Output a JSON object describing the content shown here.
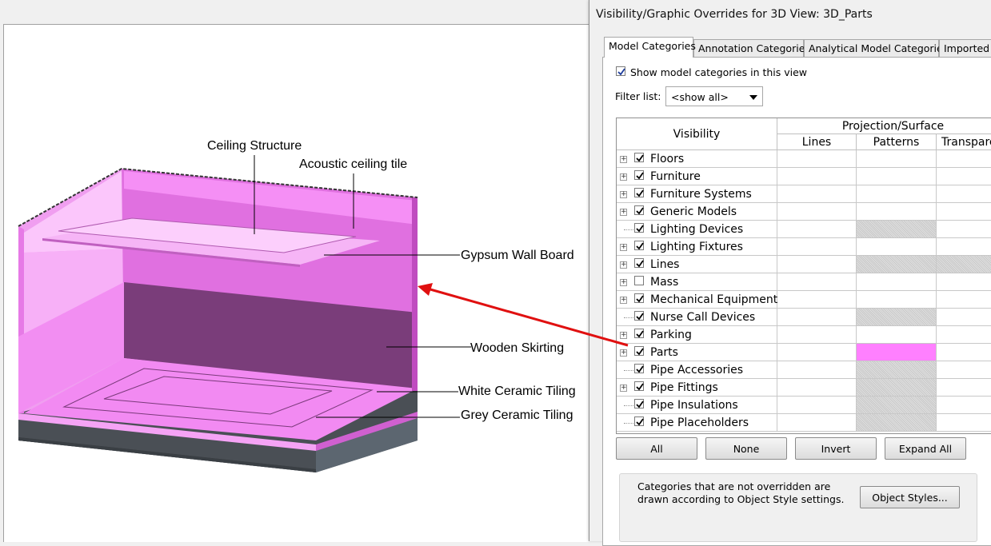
{
  "dialog": {
    "title": "Visibility/Graphic Overrides for 3D View: 3D_Parts",
    "tabs": [
      "Model Categories",
      "Annotation Categories",
      "Analytical Model Categories",
      "Imported C"
    ],
    "show_model_label": "Show model categories in this view",
    "show_model_checked": true,
    "filter_label": "Filter list:",
    "filter_value": "<show all>",
    "columns": {
      "visibility": "Visibility",
      "group": "Projection/Surface",
      "lines": "Lines",
      "patterns": "Patterns",
      "transparency": "Transpare"
    },
    "rows": [
      {
        "name": "Floors",
        "expand": true,
        "checked": true,
        "patterns": "",
        "trans": ""
      },
      {
        "name": "Furniture",
        "expand": true,
        "checked": true,
        "patterns": "",
        "trans": ""
      },
      {
        "name": "Furniture Systems",
        "expand": true,
        "checked": true,
        "patterns": "",
        "trans": ""
      },
      {
        "name": "Generic Models",
        "expand": true,
        "checked": true,
        "patterns": "",
        "trans": ""
      },
      {
        "name": "Lighting Devices",
        "expand": false,
        "checked": true,
        "patterns": "hatch",
        "trans": ""
      },
      {
        "name": "Lighting Fixtures",
        "expand": true,
        "checked": true,
        "patterns": "",
        "trans": ""
      },
      {
        "name": "Lines",
        "expand": true,
        "checked": true,
        "patterns": "hatch",
        "trans": "hatch"
      },
      {
        "name": "Mass",
        "expand": true,
        "checked": false,
        "patterns": "",
        "trans": ""
      },
      {
        "name": "Mechanical Equipment",
        "expand": true,
        "checked": true,
        "patterns": "",
        "trans": ""
      },
      {
        "name": "Nurse Call Devices",
        "expand": false,
        "checked": true,
        "patterns": "hatch",
        "trans": ""
      },
      {
        "name": "Parking",
        "expand": true,
        "checked": true,
        "patterns": "",
        "trans": ""
      },
      {
        "name": "Parts",
        "expand": true,
        "checked": true,
        "patterns": "pink",
        "trans": ""
      },
      {
        "name": "Pipe Accessories",
        "expand": false,
        "checked": true,
        "patterns": "hatch",
        "trans": ""
      },
      {
        "name": "Pipe Fittings",
        "expand": true,
        "checked": true,
        "patterns": "hatch",
        "trans": ""
      },
      {
        "name": "Pipe Insulations",
        "expand": false,
        "checked": true,
        "patterns": "hatch",
        "trans": ""
      },
      {
        "name": "Pipe Placeholders",
        "expand": false,
        "checked": true,
        "patterns": "hatch",
        "trans": ""
      }
    ],
    "buttons": {
      "all": "All",
      "none": "None",
      "invert": "Invert",
      "expand_all": "Expand All"
    },
    "note": "Categories that are not overridden are drawn according to Object Style settings.",
    "object_styles": "Object Styles..."
  },
  "model": {
    "labels": {
      "ceiling_structure": "Ceiling Structure",
      "acoustic_tile": "Acoustic ceiling tile",
      "gypsum": "Gypsum Wall Board",
      "skirting": "Wooden Skirting",
      "white_tiling": "White Ceramic Tiling",
      "grey_tiling": "Grey Ceramic Tiling"
    }
  },
  "colors": {
    "part_pink": "#ff80ff",
    "arrow_red": "#e01010",
    "base_dark": "#3c4146"
  }
}
